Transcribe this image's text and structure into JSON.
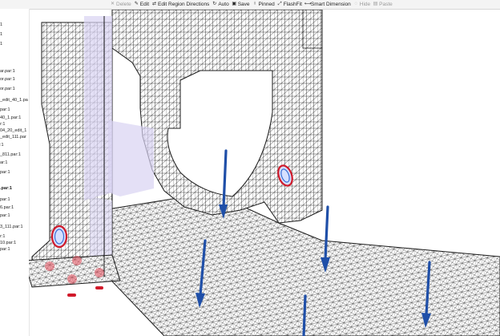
{
  "toolbar": {
    "buttons": [
      {
        "label": "Delete",
        "icon": "delete-icon",
        "disabled": true
      },
      {
        "label": "Edit",
        "icon": "edit-icon",
        "disabled": false
      },
      {
        "label": "Edit Region Directions",
        "icon": "region-directions-icon",
        "disabled": false
      },
      {
        "label": "Auto",
        "icon": "auto-icon",
        "disabled": false
      },
      {
        "label": "Save",
        "icon": "save-icon",
        "disabled": false
      },
      {
        "label": "Pinned",
        "icon": "pin-icon",
        "disabled": false
      },
      {
        "label": "FlashFit",
        "icon": "flashfit-icon",
        "disabled": false
      },
      {
        "label": "Smart Dimension",
        "icon": "smart-dimension-icon",
        "disabled": false
      },
      {
        "label": "Hide",
        "icon": "hide-icon",
        "disabled": true
      },
      {
        "label": "Paste",
        "icon": "paste-icon",
        "disabled": true
      }
    ]
  },
  "feature_tree": {
    "items": [
      {
        "label": "1",
        "bold": false
      },
      {
        "label": "1",
        "bold": false
      },
      {
        "label": "1",
        "bold": false
      },
      {
        "label": "ar.par:1",
        "bold": false
      },
      {
        "label": "or.par:1",
        "bold": false
      },
      {
        "label": "or.par:1",
        "bold": false
      },
      {
        "label": "_edit_40_1.pa",
        "bold": false
      },
      {
        "label": "par:1",
        "bold": false
      },
      {
        "label": "40_1.par:1",
        "bold": false
      },
      {
        "label": "r:1",
        "bold": false
      },
      {
        "label": "04_20_edit_1",
        "bold": false
      },
      {
        "label": "_edit_111.par",
        "bold": false
      },
      {
        "label": ":1",
        "bold": false
      },
      {
        "label": "_811.par:1",
        "bold": false
      },
      {
        "label": "ar:1",
        "bold": false
      },
      {
        "label": "par:1",
        "bold": false
      },
      {
        "label": ".par:1",
        "bold": true
      },
      {
        "label": "par:1",
        "bold": false
      },
      {
        "label": "6.par:1",
        "bold": false
      },
      {
        "label": "par:1",
        "bold": false
      },
      {
        "label": "3_111.par:1",
        "bold": false
      },
      {
        "label": "r:1",
        "bold": false
      },
      {
        "label": "10.par:1",
        "bold": false
      },
      {
        "label": "par:1",
        "bold": false
      }
    ]
  },
  "colors": {
    "mesh_line": "#2a2a2a",
    "load_arrow": "#1f4fa8",
    "constraint_red": "#d11a2a",
    "constraint_blue": "#3a6fd8",
    "highlight_face": "#d9d3f2"
  }
}
